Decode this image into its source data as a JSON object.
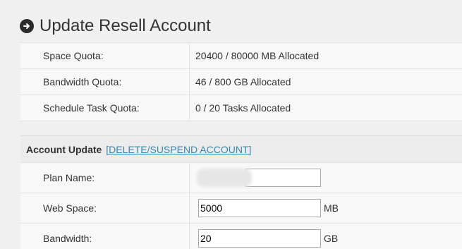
{
  "page": {
    "title": "Update Resell Account",
    "title_icon": "arrow-circle-right-icon"
  },
  "quotas": [
    {
      "label": "Space Quota:",
      "value": "20400 / 80000 MB Allocated"
    },
    {
      "label": "Bandwidth Quota:",
      "value": "46 / 800 GB Allocated"
    },
    {
      "label": "Schedule Task Quota:",
      "value": "0 / 20 Tasks Allocated"
    }
  ],
  "account_update": {
    "heading": "Account Update",
    "delete_link": "[DELETE/SUSPEND ACCOUNT]",
    "link_color": "#3a87ad",
    "fields": {
      "plan_name": {
        "label": "Plan Name:",
        "value": ""
      },
      "web_space": {
        "label": "Web Space:",
        "value": "5000",
        "unit": "MB"
      },
      "bandwidth": {
        "label": "Bandwidth:",
        "value": "20",
        "unit": "GB"
      }
    }
  }
}
